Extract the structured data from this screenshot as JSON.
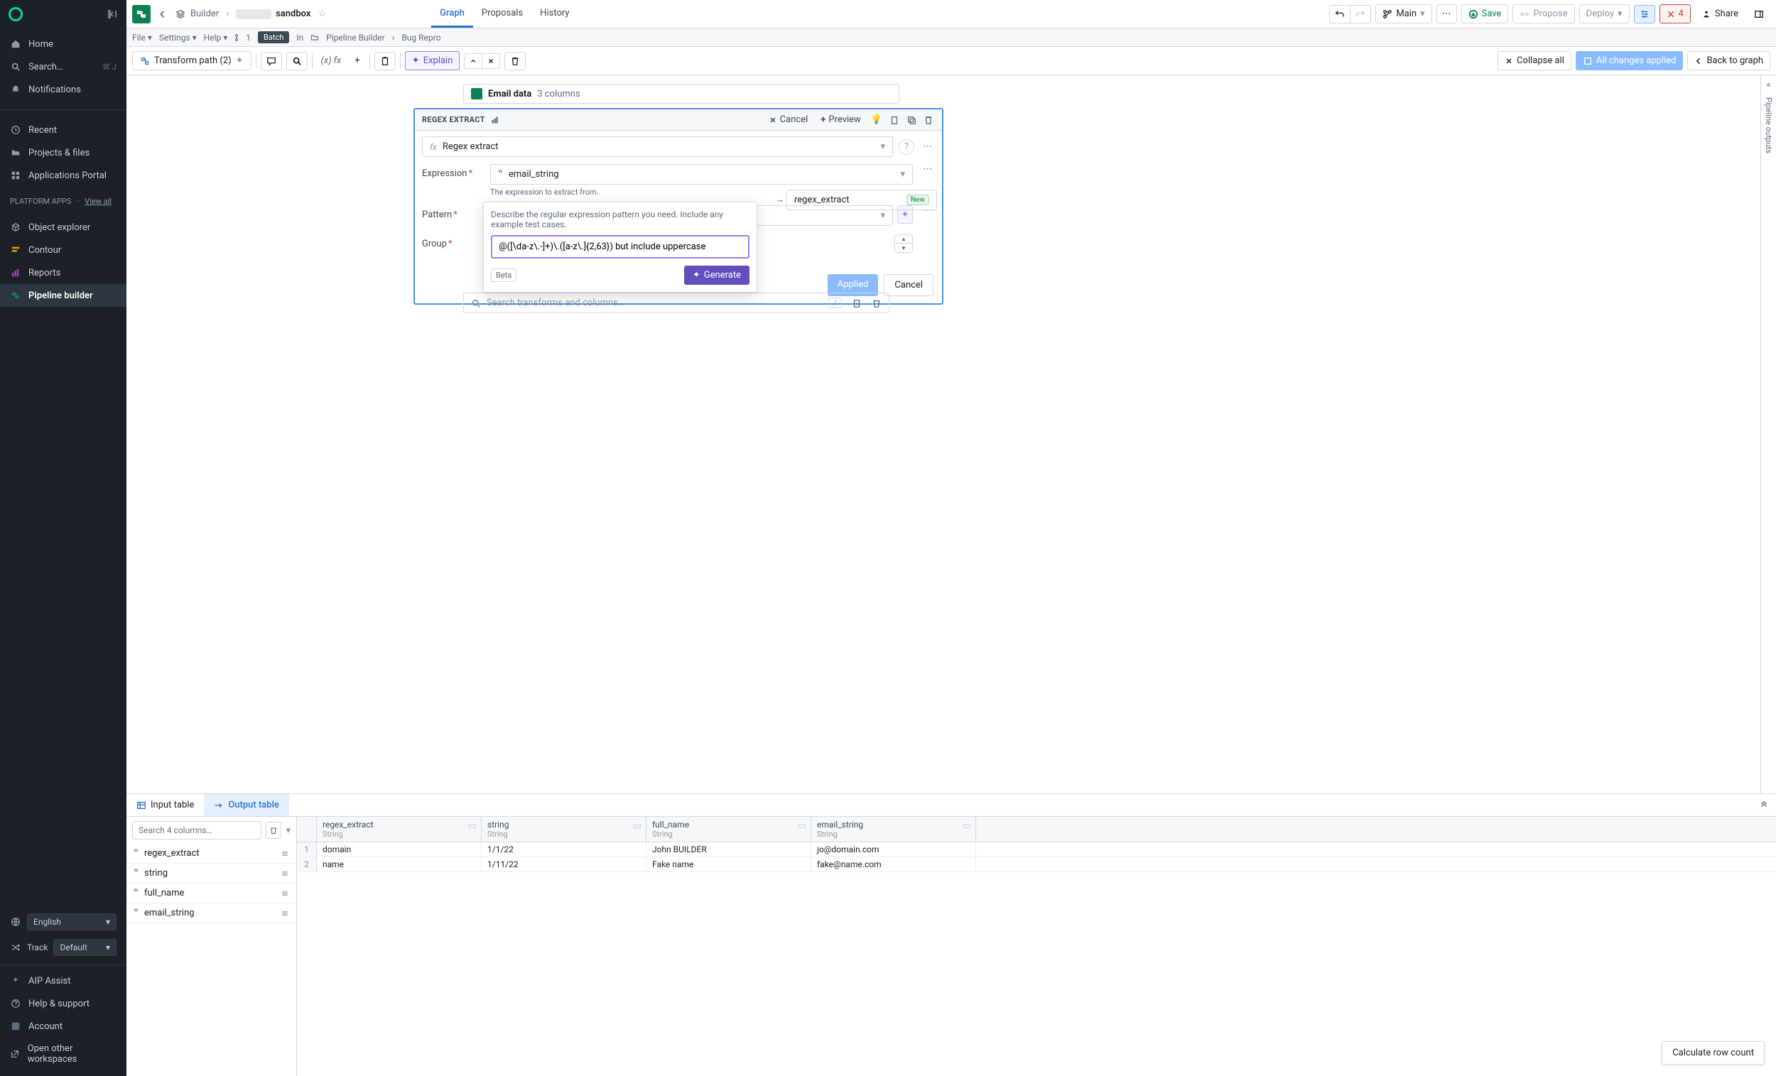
{
  "sidebar": {
    "home": "Home",
    "search": "Search…",
    "search_shortcut": "⌘ J",
    "notifications": "Notifications",
    "recent": "Recent",
    "projects": "Projects & files",
    "portal": "Applications Portal",
    "platform_apps": "PLATFORM APPS",
    "view_all": "View all",
    "object_explorer": "Object explorer",
    "contour": "Contour",
    "reports": "Reports",
    "pipeline_builder": "Pipeline builder",
    "language": "English",
    "track_label": "Track",
    "track_value": "Default",
    "aip": "AIP Assist",
    "help": "Help & support",
    "account": "Account",
    "open_ws": "Open other workspaces"
  },
  "topbar": {
    "builder": "Builder",
    "title": "sandbox",
    "tabs": {
      "graph": "Graph",
      "proposals": "Proposals",
      "history": "History"
    },
    "main": "Main",
    "save": "Save",
    "propose": "Propose",
    "deploy": "Deploy",
    "errors": "4",
    "share": "Share"
  },
  "subbar": {
    "file": "File",
    "settings": "Settings",
    "help": "Help",
    "count": "1",
    "batch": "Batch",
    "in": "In",
    "pb": "Pipeline Builder",
    "br": "Bug Repro"
  },
  "toolbar": {
    "transform_path": "Transform path (2)",
    "explain": "Explain",
    "collapse": "Collapse all",
    "applied": "All changes applied",
    "back": "Back to graph"
  },
  "email_chip": {
    "title": "Email data",
    "cols": "3 columns"
  },
  "card": {
    "title": "REGEX EXTRACT",
    "cancel": "Cancel",
    "preview": "Preview",
    "fn": "Regex extract",
    "expr_label": "Expression",
    "expr_value": "email_string",
    "expr_hint": "The expression to extract from.",
    "pattern_label": "Pattern",
    "pattern_value": "@([\\da-z\\.-]+)\\.([a-z\\.]{2,63})",
    "group_label": "Group",
    "applied": "Applied",
    "cancel2": "Cancel",
    "output": "regex_extract",
    "new": "New"
  },
  "popover": {
    "hint": "Describe the regular expression pattern you need. Include any example test cases.",
    "value": "@([\\da-z\\.-]+)\\.([a-z\\.]{2,63}) but include uppercase",
    "beta": "Beta",
    "generate": "Generate"
  },
  "search_tf": {
    "placeholder": "Search transforms and columns…",
    "slash": "/"
  },
  "right_rail": "Pipeline outputs",
  "bottom": {
    "input": "Input table",
    "output": "Output table",
    "search_placeholder": "Search 4 columns…",
    "columns": [
      "regex_extract",
      "string",
      "full_name",
      "email_string"
    ],
    "headers": [
      {
        "name": "regex_extract",
        "type": "String"
      },
      {
        "name": "string",
        "type": "String"
      },
      {
        "name": "full_name",
        "type": "String"
      },
      {
        "name": "email_string",
        "type": "String"
      }
    ],
    "rows": [
      {
        "n": "1",
        "c": [
          "domain",
          "1/1/22",
          "John BUILDER",
          "jo@domain.com"
        ]
      },
      {
        "n": "2",
        "c": [
          "name",
          "1/11/22",
          "Fake name",
          "fake@name.com"
        ]
      }
    ],
    "calc": "Calculate row count"
  }
}
